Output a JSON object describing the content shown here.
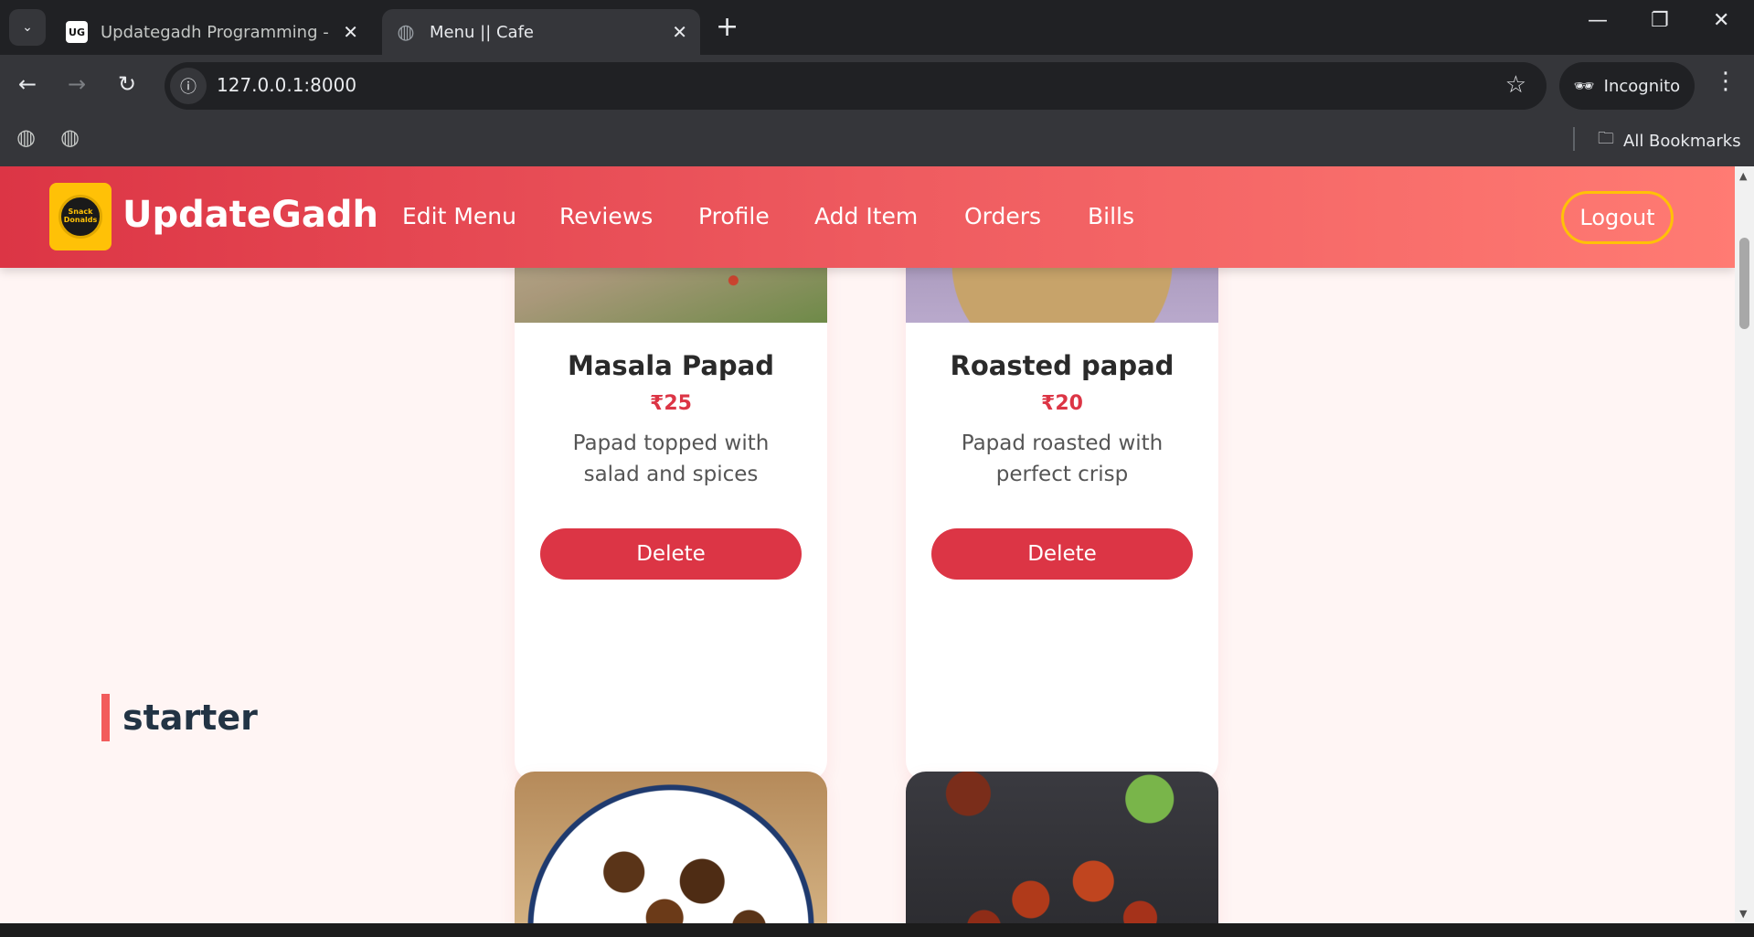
{
  "browser": {
    "tabs": [
      {
        "title": "Updategadh Programming - Up",
        "favicon": "UG"
      },
      {
        "title": "Menu || Cafe",
        "favicon": "globe-icon"
      }
    ],
    "url": "127.0.0.1:8000",
    "incognito_label": "Incognito",
    "all_bookmarks_label": "All Bookmarks"
  },
  "site": {
    "brand": "UpdateGadh",
    "logo_text": "Snack Donalds",
    "nav": [
      "Edit Menu",
      "Reviews",
      "Profile",
      "Add Item",
      "Orders",
      "Bills"
    ],
    "logout_label": "Logout"
  },
  "menu_items": [
    {
      "name": "Masala Papad",
      "price": "₹25",
      "description": "Papad topped with salad and spices",
      "delete_label": "Delete"
    },
    {
      "name": "Roasted papad",
      "price": "₹20",
      "description": "Papad roasted with perfect crisp",
      "delete_label": "Delete"
    }
  ],
  "sections": [
    {
      "title": "starter"
    }
  ],
  "colors": {
    "brand_red": "#dc3545",
    "nav_gradient_end": "#ff7b73",
    "logout_border": "#ffc107",
    "page_bg": "#fff5f4"
  }
}
